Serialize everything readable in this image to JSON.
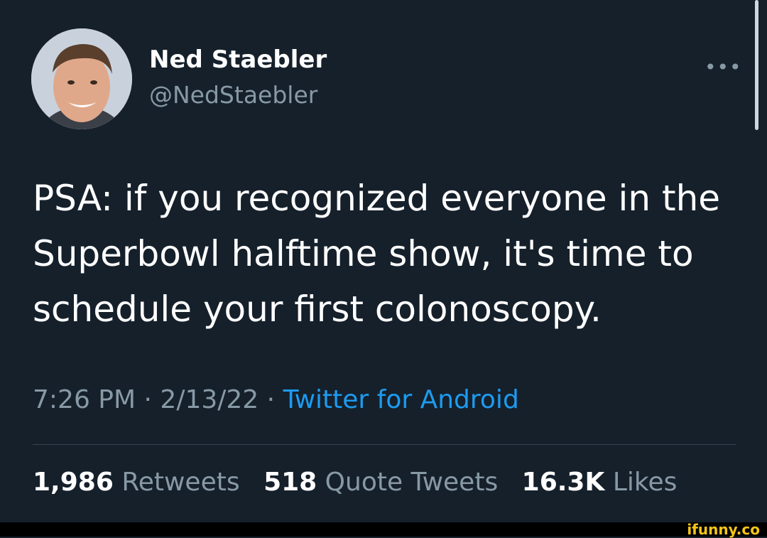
{
  "author": {
    "name": "Ned Staebler",
    "handle": "@NedStaebler"
  },
  "tweet": {
    "text": "PSA: if you recognized everyone in the Superbowl halftime show, it's time to schedule your first colonoscopy.",
    "time": "7:26 PM",
    "date": "2/13/22",
    "source": "Twitter for Android",
    "separator": "·"
  },
  "stats": {
    "retweets_count": "1,986",
    "retweets_label": "Retweets",
    "quotes_count": "518",
    "quotes_label": "Quote Tweets",
    "likes_count": "16.3K",
    "likes_label": "Likes"
  },
  "more_icon": "more-horizontal-icon",
  "watermark": "ifunny.co",
  "colors": {
    "background": "#15202b",
    "text": "#ffffff",
    "secondary": "#8899a6",
    "link": "#1d9bf0"
  }
}
